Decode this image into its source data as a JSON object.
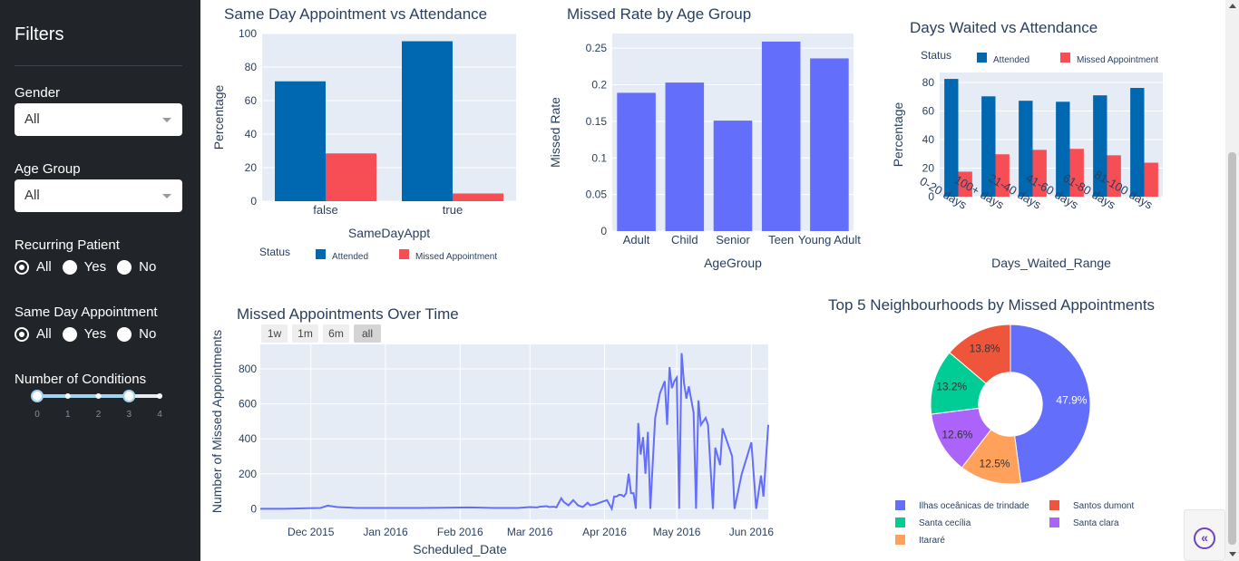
{
  "sidebar": {
    "title": "Filters",
    "gender": {
      "label": "Gender",
      "value": "All"
    },
    "age_group": {
      "label": "Age Group",
      "value": "All"
    },
    "recurring": {
      "label": "Recurring Patient",
      "options": [
        "All",
        "Yes",
        "No"
      ],
      "selected": "All"
    },
    "same_day": {
      "label": "Same Day Appointment",
      "options": [
        "All",
        "Yes",
        "No"
      ],
      "selected": "All"
    },
    "conditions": {
      "label": "Number of Conditions",
      "ticks": [
        "0",
        "1",
        "2",
        "3",
        "4"
      ],
      "range": [
        0,
        3
      ]
    }
  },
  "colors": {
    "attended": "#0068b0",
    "missed": "#f74e55",
    "series": "#636efa",
    "plot_bg": "#e5ecf6",
    "sidebar_bg": "#212529",
    "slider": "#a3d4ef"
  },
  "chart_data": [
    {
      "id": "same_day",
      "type": "bar",
      "title": "Same Day Appointment vs Attendance",
      "xlabel": "SameDayAppt",
      "ylabel": "Percentage",
      "categories": [
        "false",
        "true"
      ],
      "series": [
        {
          "name": "Attended",
          "values": [
            71.5,
            95.4
          ]
        },
        {
          "name": "Missed Appointment",
          "values": [
            28.5,
            4.6
          ]
        }
      ],
      "ylim": [
        0,
        100
      ],
      "yticks": [
        0,
        20,
        40,
        60,
        80,
        100
      ],
      "legend_title": "Status",
      "legend_position": "bottom"
    },
    {
      "id": "age_group",
      "type": "bar",
      "title": "Missed Rate by Age Group",
      "xlabel": "AgeGroup",
      "ylabel": "Missed Rate",
      "categories": [
        "Adult",
        "Child",
        "Senior",
        "Teen",
        "Young Adult"
      ],
      "values": [
        0.189,
        0.203,
        0.151,
        0.259,
        0.236
      ],
      "ylim": [
        0,
        0.27
      ],
      "yticks": [
        "0",
        "0.05",
        "0.1",
        "0.15",
        "0.2",
        "0.25"
      ]
    },
    {
      "id": "days_waited",
      "type": "bar",
      "title": "Days Waited vs Attendance",
      "xlabel": "Days_Waited_Range",
      "ylabel": "Percentage",
      "categories": [
        "0-20 days",
        "100+ days",
        "21-40 days",
        "41-60 days",
        "61-80 days",
        "81-100 days"
      ],
      "series": [
        {
          "name": "Attended",
          "values": [
            82.5,
            70.3,
            67.2,
            66.5,
            71.0,
            76.2
          ]
        },
        {
          "name": "Missed Appointment",
          "values": [
            17.5,
            29.7,
            32.8,
            33.5,
            29.0,
            23.8
          ]
        }
      ],
      "ylim": [
        0,
        87
      ],
      "yticks": [
        0,
        20,
        40,
        60,
        80
      ],
      "legend_title": "Status",
      "legend_position": "top"
    },
    {
      "id": "over_time",
      "type": "line",
      "title": "Missed Appointments Over Time",
      "xlabel": "Scheduled_Date",
      "ylabel": "Number of Missed Appointments",
      "range_buttons": [
        "1w",
        "1m",
        "6m",
        "all"
      ],
      "selected_range": "all",
      "xticks": [
        "Dec 2015",
        "Jan 2016",
        "Feb 2016",
        "Mar 2016",
        "Apr 2016",
        "May 2016",
        "Jun 2016"
      ],
      "yticks": [
        0,
        200,
        400,
        600,
        800
      ],
      "ylim": [
        -60,
        940
      ],
      "x_start": "2015-11-10",
      "x_end": "2016-06-08",
      "x": [
        "2015-11-10",
        "2015-11-20",
        "2015-11-30",
        "2015-12-05",
        "2015-12-08",
        "2015-12-12",
        "2015-12-20",
        "2016-01-05",
        "2016-01-15",
        "2016-01-25",
        "2016-02-05",
        "2016-02-15",
        "2016-02-25",
        "2016-03-01",
        "2016-03-04",
        "2016-03-05",
        "2016-03-08",
        "2016-03-09",
        "2016-03-11",
        "2016-03-12",
        "2016-03-14",
        "2016-03-15",
        "2016-03-17",
        "2016-03-19",
        "2016-03-21",
        "2016-03-23",
        "2016-03-25",
        "2016-03-26",
        "2016-03-28",
        "2016-03-29",
        "2016-03-31",
        "2016-04-02",
        "2016-04-04",
        "2016-04-05",
        "2016-04-06",
        "2016-04-07",
        "2016-04-08",
        "2016-04-09",
        "2016-04-10",
        "2016-04-11",
        "2016-04-12",
        "2016-04-13",
        "2016-04-14",
        "2016-04-15",
        "2016-04-16",
        "2016-04-17",
        "2016-04-18",
        "2016-04-19",
        "2016-04-20",
        "2016-04-22",
        "2016-04-24",
        "2016-04-26",
        "2016-04-27",
        "2016-04-28",
        "2016-04-29",
        "2016-04-30",
        "2016-05-01",
        "2016-05-02",
        "2016-05-03",
        "2016-05-04",
        "2016-05-05",
        "2016-05-06",
        "2016-05-08",
        "2016-05-09",
        "2016-05-10",
        "2016-05-11",
        "2016-05-13",
        "2016-05-14",
        "2016-05-16",
        "2016-05-17",
        "2016-05-18",
        "2016-05-19",
        "2016-05-20",
        "2016-05-24",
        "2016-05-25",
        "2016-05-28",
        "2016-06-01",
        "2016-06-03",
        "2016-06-05",
        "2016-06-06",
        "2016-06-08"
      ],
      "y": [
        0,
        0,
        3,
        5,
        18,
        10,
        5,
        5,
        5,
        6,
        8,
        5,
        5,
        10,
        8,
        12,
        15,
        10,
        12,
        8,
        60,
        40,
        20,
        50,
        20,
        10,
        35,
        20,
        25,
        30,
        40,
        50,
        0,
        70,
        70,
        80,
        80,
        70,
        90,
        200,
        90,
        90,
        0,
        490,
        310,
        410,
        200,
        440,
        0,
        520,
        660,
        730,
        480,
        810,
        690,
        730,
        750,
        0,
        890,
        720,
        630,
        700,
        550,
        0,
        620,
        480,
        520,
        480,
        0,
        350,
        300,
        250,
        460,
        300,
        0,
        200,
        380,
        0
      ],
      "y_full": [
        0,
        0,
        3,
        5,
        18,
        10,
        5,
        5,
        5,
        6,
        8,
        5,
        5,
        10,
        8,
        12,
        15,
        10,
        12,
        8,
        60,
        40,
        20,
        50,
        20,
        10,
        35,
        20,
        25,
        30,
        40,
        50,
        0,
        70,
        70,
        80,
        80,
        70,
        90,
        200,
        90,
        90,
        0,
        490,
        310,
        410,
        200,
        440,
        0,
        520,
        660,
        730,
        480,
        810,
        690,
        730,
        750,
        0,
        890,
        720,
        630,
        700,
        550,
        0,
        620,
        480,
        520,
        480,
        0,
        350,
        300,
        250,
        460,
        300,
        0,
        200,
        380,
        0,
        190,
        70,
        480
      ]
    },
    {
      "id": "neighbourhoods",
      "type": "pie",
      "title": "Top 5 Neighbourhoods by Missed Appointments",
      "labels": [
        "Ilhas oceânicas de trindade",
        "Itararé",
        "Santa clara",
        "Santa cecília",
        "Santos dumont"
      ],
      "values": [
        47.9,
        12.5,
        12.6,
        13.2,
        13.8
      ],
      "value_labels": [
        "47.9%",
        "12.5%",
        "12.6%",
        "13.2%",
        "13.8%"
      ],
      "colors": [
        "#636efa",
        "#ffa15a",
        "#ab63fa",
        "#00cc96",
        "#ef553b"
      ],
      "legend_order": [
        "Ilhas oceânicas de trindade",
        "Santos dumont",
        "Santa cecília",
        "Santa clara",
        "Itararé"
      ],
      "hole": 0.4
    }
  ]
}
